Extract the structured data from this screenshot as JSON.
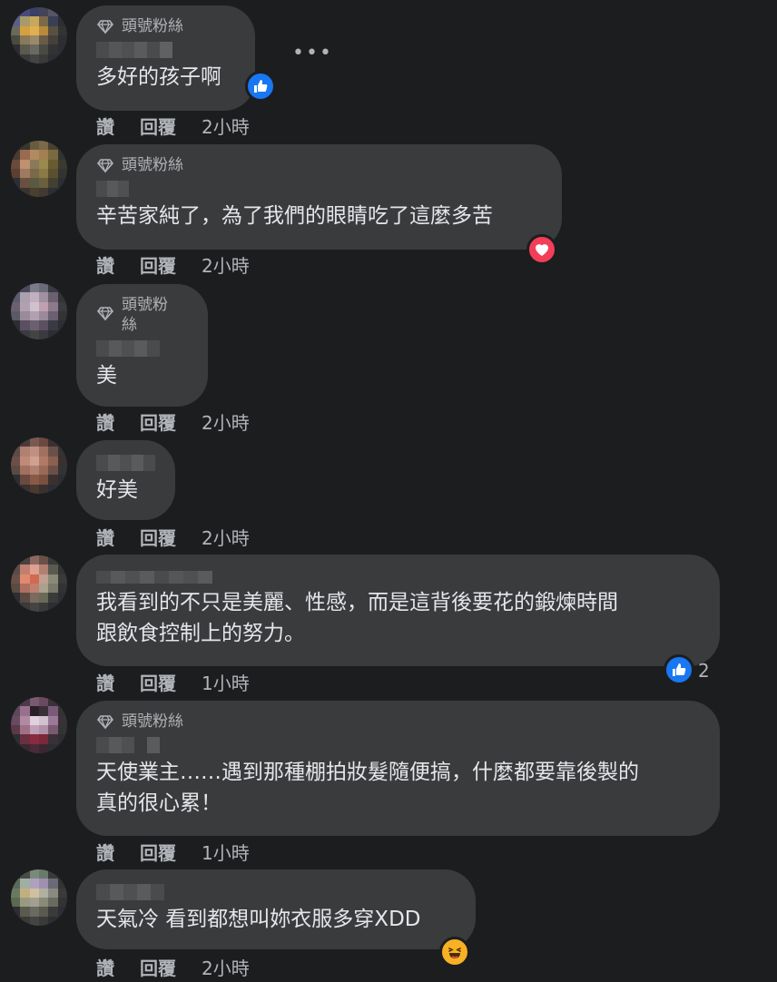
{
  "labels": {
    "like": "讚",
    "reply": "回覆",
    "badge": "頭號粉絲",
    "more": "•••"
  },
  "comments": [
    {
      "badge": "頭號粉絲",
      "text": "多好的孩子啊",
      "time": "2小時",
      "reaction": "like"
    },
    {
      "badge": "頭號粉絲",
      "text": "辛苦家純了，為了我們的眼睛吃了這麼多苦",
      "time": "2小時",
      "reaction": "love"
    },
    {
      "badge": "頭號粉\n絲",
      "text": "美",
      "time": "2小時"
    },
    {
      "text": "好美",
      "time": "2小時"
    },
    {
      "text": "我看到的不只是美麗、性感，而是這背後要花的鍛煉時間\n跟飲食控制上的努力。",
      "time": "1小時",
      "reaction": "like",
      "reaction_count": "2"
    },
    {
      "badge": "頭號粉絲",
      "text": "天使業主……遇到那種棚拍妝髮隨便搞，什麼都要靠後製的\n真的很心累！",
      "time": "1小時"
    },
    {
      "text": "天氣冷 看到都想叫妳衣服多穿XDD",
      "time": "2小時",
      "reaction": "haha"
    }
  ],
  "colors": {
    "background": "#1c1d1f",
    "bubble": "#3a3b3c",
    "text": "#e4e6eb",
    "secondary": "#b0b3b8",
    "like": "#1877f2",
    "love": "#f33e58",
    "haha": "#f7b125"
  }
}
